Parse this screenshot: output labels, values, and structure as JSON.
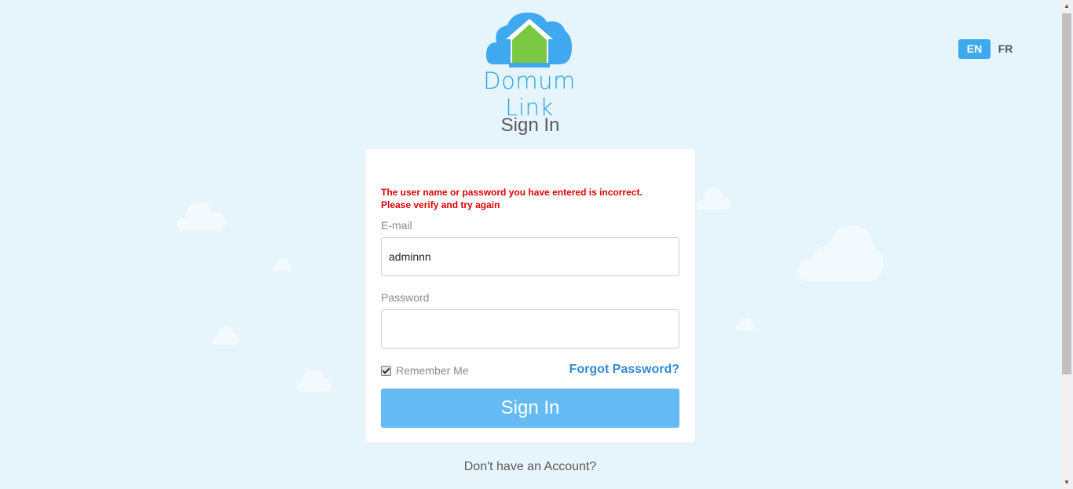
{
  "brand": {
    "name": "Domum Link",
    "logo_icon": "house-cloud-icon",
    "colors": {
      "cloud": "#3fa9ef",
      "house": "#7bc943",
      "text": "#2aa3e4"
    }
  },
  "language": {
    "options": [
      "EN",
      "FR"
    ],
    "selected": "EN"
  },
  "page": {
    "title": "Sign In"
  },
  "form": {
    "error_line1": "The user name or password you have entered is incorrect.",
    "error_line2": "Please verify and try again",
    "email_label": "E-mail",
    "email_value": "adminnn",
    "password_label": "Password",
    "password_value": "",
    "remember_label": "Remember Me",
    "remember_checked": true,
    "forgot_label": "Forgot Password?",
    "submit_label": "Sign In"
  },
  "footer": {
    "no_account": "Don't have an Account?"
  },
  "theme": {
    "background": "#e6f4fb",
    "accent": "#66bbf4",
    "error": "#e00000",
    "link": "#3289d3"
  }
}
